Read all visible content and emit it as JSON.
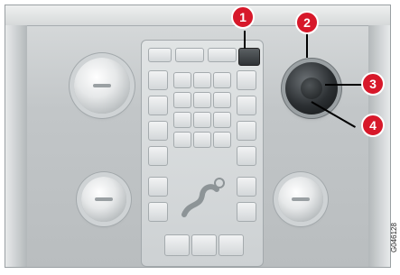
{
  "callouts": [
    {
      "label": "1"
    },
    {
      "label": "2"
    },
    {
      "label": "3"
    },
    {
      "label": "4"
    }
  ],
  "image_code": "G046128",
  "colors": {
    "callout": "#d7182a",
    "panel": "#c4c8ca",
    "dial": "#2b2f32"
  },
  "icons": {
    "seat": "seat-icon",
    "knob": "knob-icon"
  }
}
